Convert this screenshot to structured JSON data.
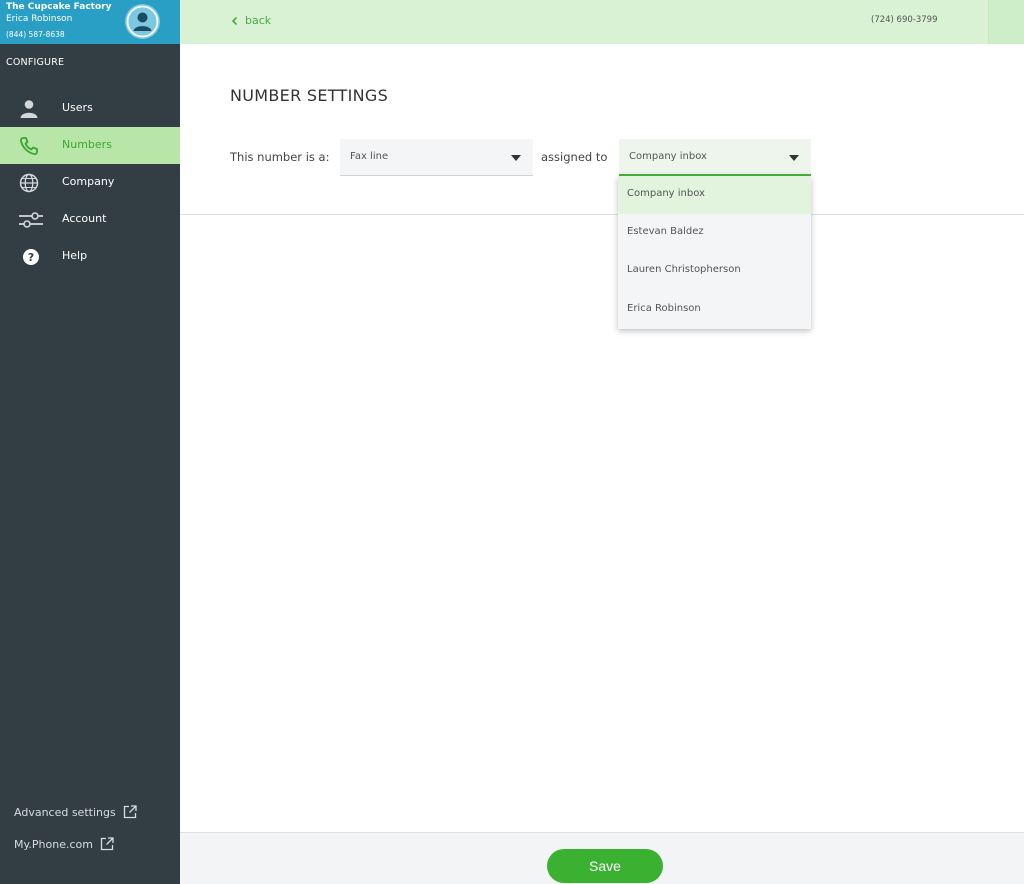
{
  "account": {
    "company": "The Cupcake Factory",
    "user": "Erica Robinson",
    "phone": "(844) 587-8638"
  },
  "sidebar": {
    "section_label": "CONFIGURE",
    "items": [
      {
        "label": "Users",
        "icon": "user-icon"
      },
      {
        "label": "Numbers",
        "icon": "phone-icon",
        "active": true
      },
      {
        "label": "Company",
        "icon": "globe-icon"
      },
      {
        "label": "Account",
        "icon": "sliders-icon"
      },
      {
        "label": "Help",
        "icon": "help-icon"
      }
    ],
    "links": [
      {
        "label": "Advanced settings",
        "icon": "external-link-icon"
      },
      {
        "label": "My.Phone.com",
        "icon": "external-link-icon"
      }
    ]
  },
  "topbar": {
    "back_label": "back",
    "phone_number": "(724) 690-3799"
  },
  "main": {
    "title": "NUMBER SETTINGS",
    "number_type_label": "This number is a:",
    "number_type_value": "Fax line",
    "assigned_label": "assigned to",
    "assigned_value": "Company inbox",
    "assigned_options": [
      "Company inbox",
      "Estevan Baldez",
      "Lauren Christopherson",
      "Erica Robinson"
    ]
  },
  "footer": {
    "save_label": "Save"
  },
  "colors": {
    "sidebar_bg": "#323e44",
    "account_bg": "#2a9fc5",
    "accent_green": "#3ab131",
    "topbar_bg": "#d8f2d3",
    "active_nav_bg": "#b8e6a9"
  }
}
